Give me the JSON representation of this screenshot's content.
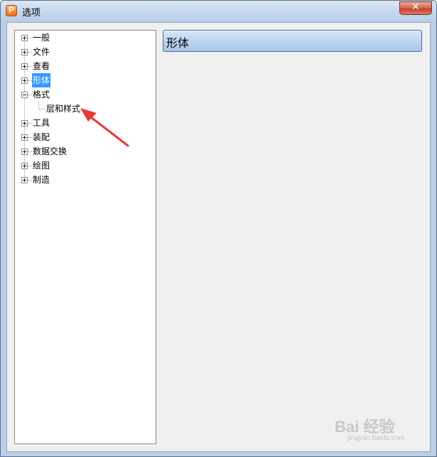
{
  "window": {
    "title": "选项",
    "app_icon_letter": "P",
    "close_symbol": "✕"
  },
  "tree": {
    "items": [
      {
        "label": "一般",
        "expander": "plus",
        "selected": false
      },
      {
        "label": "文件",
        "expander": "plus",
        "selected": false
      },
      {
        "label": "查看",
        "expander": "plus",
        "selected": false
      },
      {
        "label": "形体",
        "expander": "plus",
        "selected": true
      },
      {
        "label": "格式",
        "expander": "minus",
        "selected": false
      },
      {
        "label": "层和样式",
        "expander": "none",
        "selected": false,
        "child": true
      },
      {
        "label": "工具",
        "expander": "plus",
        "selected": false
      },
      {
        "label": "装配",
        "expander": "plus",
        "selected": false
      },
      {
        "label": "数据交换",
        "expander": "plus",
        "selected": false
      },
      {
        "label": "绘图",
        "expander": "plus",
        "selected": false
      },
      {
        "label": "制造",
        "expander": "plus",
        "selected": false
      }
    ]
  },
  "panel": {
    "header": "形体"
  },
  "watermark": {
    "brand": "Bai 经验",
    "url": "jingyan.baidu.com"
  },
  "colors": {
    "selection": "#3399ff",
    "annotation_arrow": "#e83a35",
    "close_button": "#c5432c"
  }
}
